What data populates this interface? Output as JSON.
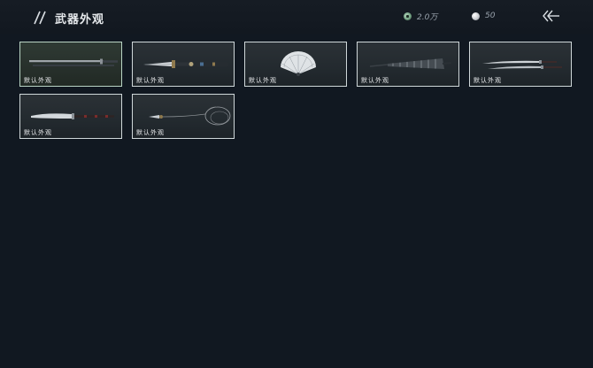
{
  "header": {
    "title": "武器外观",
    "jade_currency": "2.0万",
    "pearl_currency": "50"
  },
  "weapons": [
    {
      "label": "默认外观",
      "icon": "sword-icon",
      "selected": true
    },
    {
      "label": "默认外观",
      "icon": "dagger-icon",
      "selected": false
    },
    {
      "label": "默认外观",
      "icon": "fan-icon",
      "selected": false
    },
    {
      "label": "默认外观",
      "icon": "umbrella-icon",
      "selected": false
    },
    {
      "label": "默认外观",
      "icon": "dual-blade-icon",
      "selected": false
    },
    {
      "label": "默认外观",
      "icon": "long-blade-icon",
      "selected": false
    },
    {
      "label": "默认外观",
      "icon": "rope-dart-icon",
      "selected": false
    }
  ],
  "colors": {
    "background": "#111821",
    "card_border": "#cfd7d9",
    "accent_jade": "#6c9a7c"
  }
}
